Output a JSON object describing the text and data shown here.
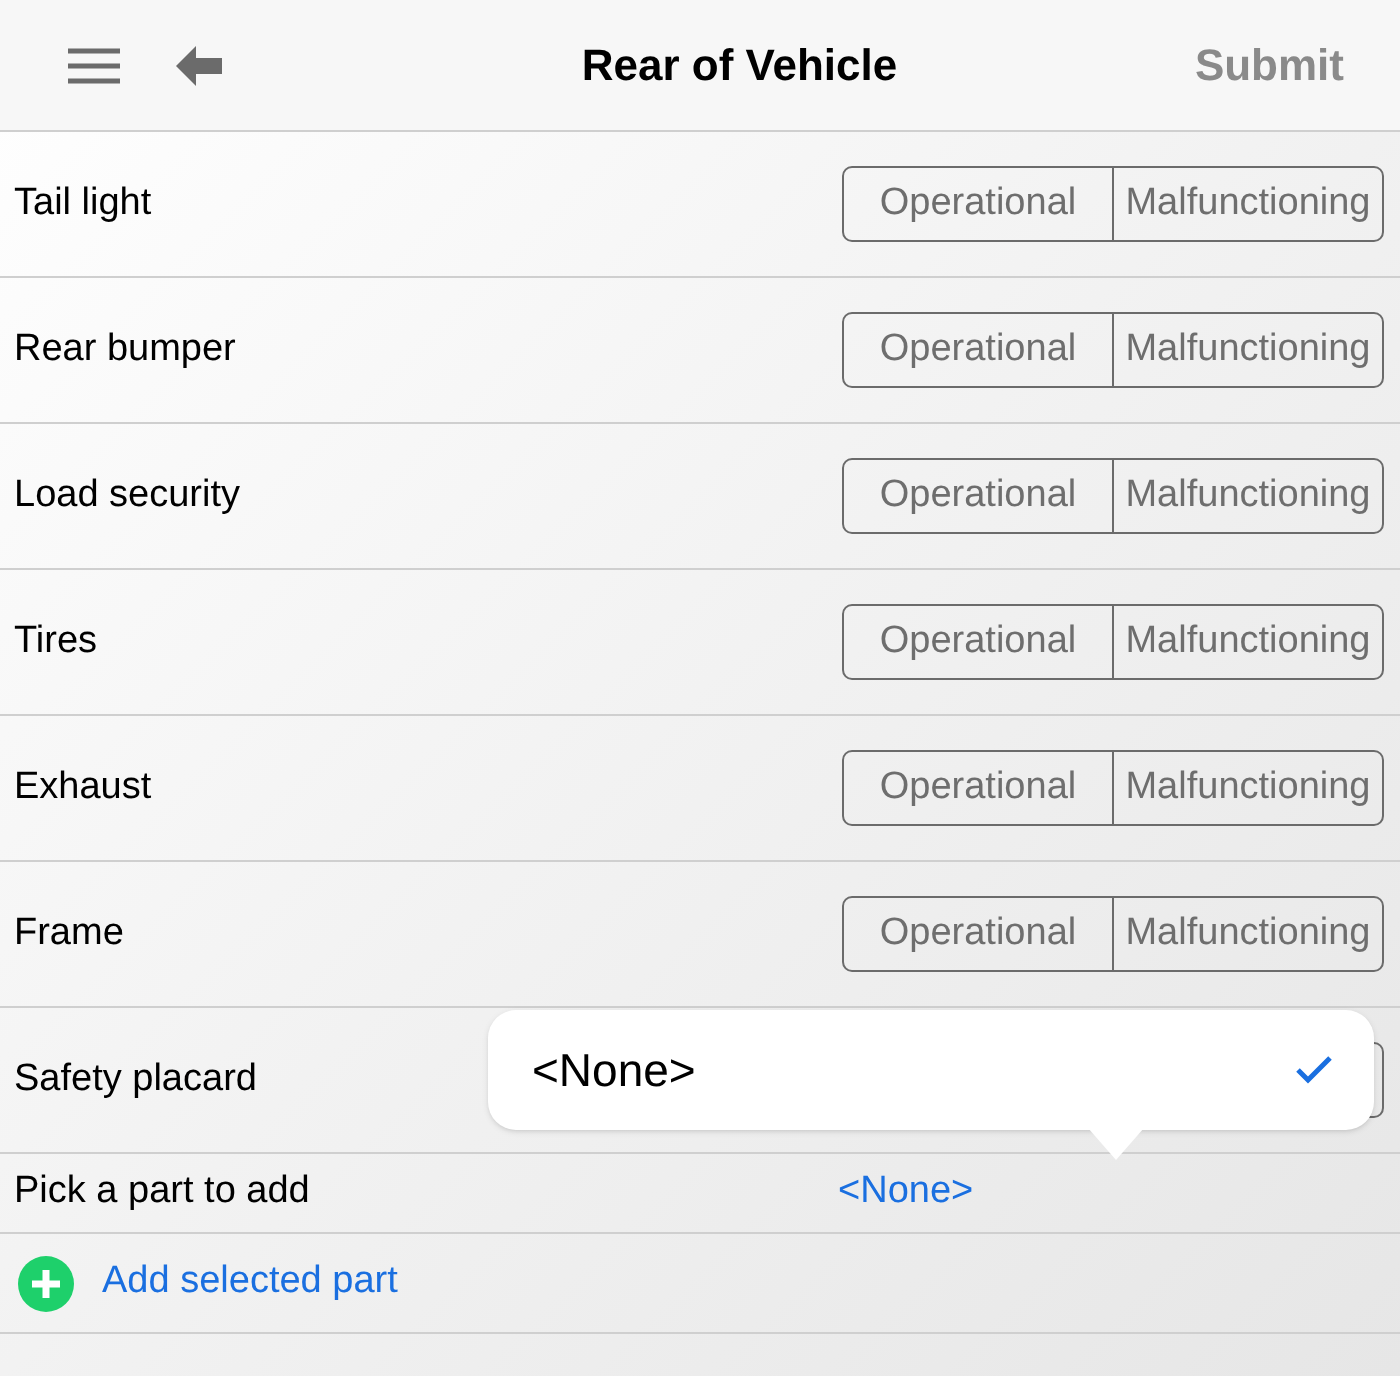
{
  "header": {
    "title": "Rear of Vehicle",
    "action": "Submit"
  },
  "items": [
    {
      "label": "Tail light",
      "options": [
        {
          "label": "Operational",
          "selected": false
        },
        {
          "label": "Malfunctioning",
          "selected": false
        }
      ]
    },
    {
      "label": "Rear bumper",
      "options": [
        {
          "label": "Operational",
          "selected": false
        },
        {
          "label": "Malfunctioning",
          "selected": false
        }
      ]
    },
    {
      "label": "Load security",
      "options": [
        {
          "label": "Operational",
          "selected": false
        },
        {
          "label": "Malfunctioning",
          "selected": false
        }
      ]
    },
    {
      "label": "Tires",
      "options": [
        {
          "label": "Operational",
          "selected": false
        },
        {
          "label": "Malfunctioning",
          "selected": false
        }
      ]
    },
    {
      "label": "Exhaust",
      "options": [
        {
          "label": "Operational",
          "selected": false
        },
        {
          "label": "Malfunctioning",
          "selected": false
        }
      ]
    },
    {
      "label": "Frame",
      "options": [
        {
          "label": "Operational",
          "selected": false
        },
        {
          "label": "Malfunctioning",
          "selected": false
        }
      ]
    },
    {
      "label": "Safety placard"
    }
  ],
  "picker": {
    "label": "Pick a part to add",
    "value": "<None>"
  },
  "add_button": "Add selected part",
  "popover": {
    "options": [
      {
        "label": "<None>",
        "selected": true
      }
    ]
  }
}
